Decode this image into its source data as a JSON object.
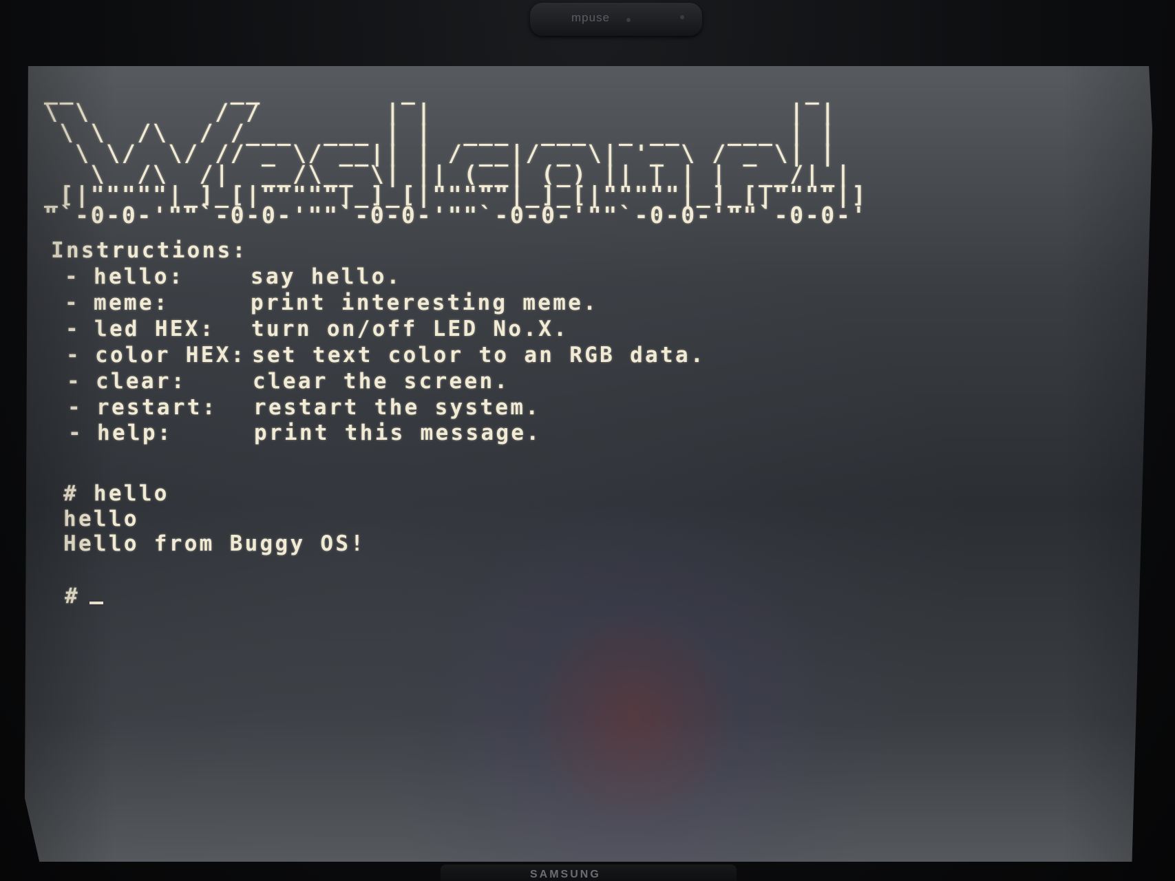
{
  "webcam": {
    "brand": "mpuse"
  },
  "monitor": {
    "brand": "SAMSUNG"
  },
  "terminal": {
    "banner_lines": [
      "__          __         _                         _ ",
      "\\ \\        / /        | |                       | |",
      " \\ \\  /\\  / /___  ___ | |  ___  ___  _ __   ___ | |",
      "  \\ \\/  \\/ // _ \\/ __|| | / __|/ _ \\| '_ \\ / _ \\| |",
      "   \\  /\\  /|  __/\\__ \\| || (__| (_) || | | |  __/|_|",
      "_[|\"\"\"\"\"|_]_[|\"\"\"\"\"|_]_[|\"\"\"\"\"|_]_[|\"\"\"\"\"|_]_[|\"\"\"\"|]",
      "\"`-0-0-'\"\"`-0-0-'\"\"`-0-0-'\"\"`-0-0-'\"\"`-0-0-'\"\"`-0-0-'"
    ],
    "heading": "Instructions:",
    "instructions": [
      {
        "dash": "-",
        "command": "hello:",
        "description": "say hello."
      },
      {
        "dash": "-",
        "command": "meme:",
        "description": "print interesting meme."
      },
      {
        "dash": "-",
        "command": "led HEX:",
        "description": "turn on/off LED No.X."
      },
      {
        "dash": "-",
        "command": "color HEX:",
        "description": "set text color to an RGB data."
      },
      {
        "dash": "-",
        "command": "clear:",
        "description": "clear the screen."
      },
      {
        "dash": "-",
        "command": "restart:",
        "description": "restart the system."
      },
      {
        "dash": "-",
        "command": "help:",
        "description": "print this message."
      }
    ],
    "history": [
      "# hello",
      "hello",
      "Hello from Buggy OS!"
    ],
    "prompt": "#",
    "text_color": "#f1ead4"
  }
}
